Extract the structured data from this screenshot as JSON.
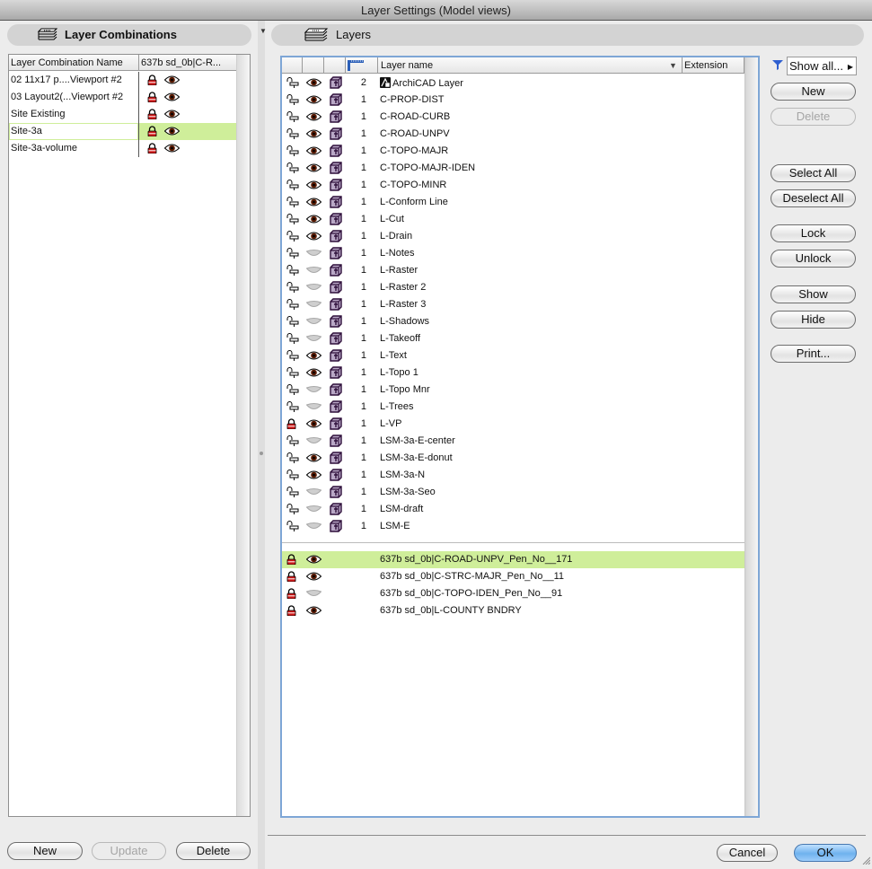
{
  "window": {
    "title": "Layer Settings (Model views)"
  },
  "layer_combinations": {
    "header": "Layer Combinations",
    "header_icon": "layer-stack-pencil-icon",
    "columns": [
      "Layer Combination Name",
      "637b sd_0b|C-R..."
    ],
    "rows": [
      {
        "name": "02 11x17 p....Viewport #2",
        "locked": true,
        "visible": true,
        "selected": false
      },
      {
        "name": "03 Layout2(...Viewport #2",
        "locked": true,
        "visible": true,
        "selected": false
      },
      {
        "name": "Site Existing",
        "locked": true,
        "visible": true,
        "selected": false
      },
      {
        "name": "Site-3a",
        "locked": true,
        "visible": true,
        "selected": true
      },
      {
        "name": "Site-3a-volume",
        "locked": true,
        "visible": true,
        "selected": false
      }
    ],
    "buttons": {
      "new": "New",
      "update": "Update",
      "delete": "Delete"
    }
  },
  "layers": {
    "header": "Layers",
    "header_icon": "layer-stack-icon",
    "columns": {
      "intersection_icon": "intersection-group-icon",
      "name": "Layer name",
      "extension": "Extension"
    },
    "rows": [
      {
        "locked": false,
        "visible": true,
        "solid": true,
        "group": "2",
        "name": "ArchiCAD Layer",
        "special": true
      },
      {
        "locked": false,
        "visible": true,
        "solid": true,
        "group": "1",
        "name": "C-PROP-DIST"
      },
      {
        "locked": false,
        "visible": true,
        "solid": true,
        "group": "1",
        "name": "C-ROAD-CURB"
      },
      {
        "locked": false,
        "visible": true,
        "solid": true,
        "group": "1",
        "name": "C-ROAD-UNPV"
      },
      {
        "locked": false,
        "visible": true,
        "solid": true,
        "group": "1",
        "name": "C-TOPO-MAJR"
      },
      {
        "locked": false,
        "visible": true,
        "solid": true,
        "group": "1",
        "name": "C-TOPO-MAJR-IDEN"
      },
      {
        "locked": false,
        "visible": true,
        "solid": true,
        "group": "1",
        "name": "C-TOPO-MINR"
      },
      {
        "locked": false,
        "visible": true,
        "solid": true,
        "group": "1",
        "name": "L-Conform Line"
      },
      {
        "locked": false,
        "visible": true,
        "solid": true,
        "group": "1",
        "name": "L-Cut"
      },
      {
        "locked": false,
        "visible": true,
        "solid": true,
        "group": "1",
        "name": "L-Drain"
      },
      {
        "locked": false,
        "visible": false,
        "solid": true,
        "group": "1",
        "name": "L-Notes"
      },
      {
        "locked": false,
        "visible": false,
        "solid": true,
        "group": "1",
        "name": "L-Raster"
      },
      {
        "locked": false,
        "visible": false,
        "solid": true,
        "group": "1",
        "name": "L-Raster 2"
      },
      {
        "locked": false,
        "visible": false,
        "solid": true,
        "group": "1",
        "name": "L-Raster 3"
      },
      {
        "locked": false,
        "visible": false,
        "solid": true,
        "group": "1",
        "name": "L-Shadows"
      },
      {
        "locked": false,
        "visible": false,
        "solid": true,
        "group": "1",
        "name": "L-Takeoff"
      },
      {
        "locked": false,
        "visible": true,
        "solid": true,
        "group": "1",
        "name": "L-Text"
      },
      {
        "locked": false,
        "visible": true,
        "solid": true,
        "group": "1",
        "name": "L-Topo 1"
      },
      {
        "locked": false,
        "visible": false,
        "solid": true,
        "group": "1",
        "name": "L-Topo Mnr"
      },
      {
        "locked": false,
        "visible": false,
        "solid": true,
        "group": "1",
        "name": "L-Trees"
      },
      {
        "locked": true,
        "visible": true,
        "solid": true,
        "group": "1",
        "name": "L-VP"
      },
      {
        "locked": false,
        "visible": false,
        "solid": true,
        "group": "1",
        "name": "LSM-3a-E-center"
      },
      {
        "locked": false,
        "visible": true,
        "solid": true,
        "group": "1",
        "name": "LSM-3a-E-donut"
      },
      {
        "locked": false,
        "visible": true,
        "solid": true,
        "group": "1",
        "name": "LSM-3a-N"
      },
      {
        "locked": false,
        "visible": false,
        "solid": true,
        "group": "1",
        "name": "LSM-3a-Seo"
      },
      {
        "locked": false,
        "visible": false,
        "solid": true,
        "group": "1",
        "name": "LSM-draft"
      },
      {
        "locked": false,
        "visible": false,
        "solid": true,
        "group": "1",
        "name": "LSM-E"
      }
    ],
    "xref_rows": [
      {
        "locked": true,
        "visible": true,
        "name": "637b sd_0b|C-ROAD-UNPV_Pen_No__171",
        "selected": true
      },
      {
        "locked": true,
        "visible": true,
        "name": "637b sd_0b|C-STRC-MAJR_Pen_No__11",
        "selected": false
      },
      {
        "locked": true,
        "visible": false,
        "name": "637b sd_0b|C-TOPO-IDEN_Pen_No__91",
        "selected": false
      },
      {
        "locked": true,
        "visible": true,
        "name": "637b sd_0b|L-COUNTY BNDRY",
        "selected": false
      }
    ]
  },
  "side_buttons": {
    "filter_label": "Show all...",
    "new": "New",
    "delete": "Delete",
    "select_all": "Select All",
    "deselect_all": "Deselect All",
    "lock": "Lock",
    "unlock": "Unlock",
    "show": "Show",
    "hide": "Hide",
    "print": "Print..."
  },
  "dialog_buttons": {
    "cancel": "Cancel",
    "ok": "OK"
  },
  "colors": {
    "selection": "#cfee9a",
    "focus_ring": "#7ea6d6",
    "lock_red": "#d01818",
    "eye_brown": "#5a1a00"
  }
}
